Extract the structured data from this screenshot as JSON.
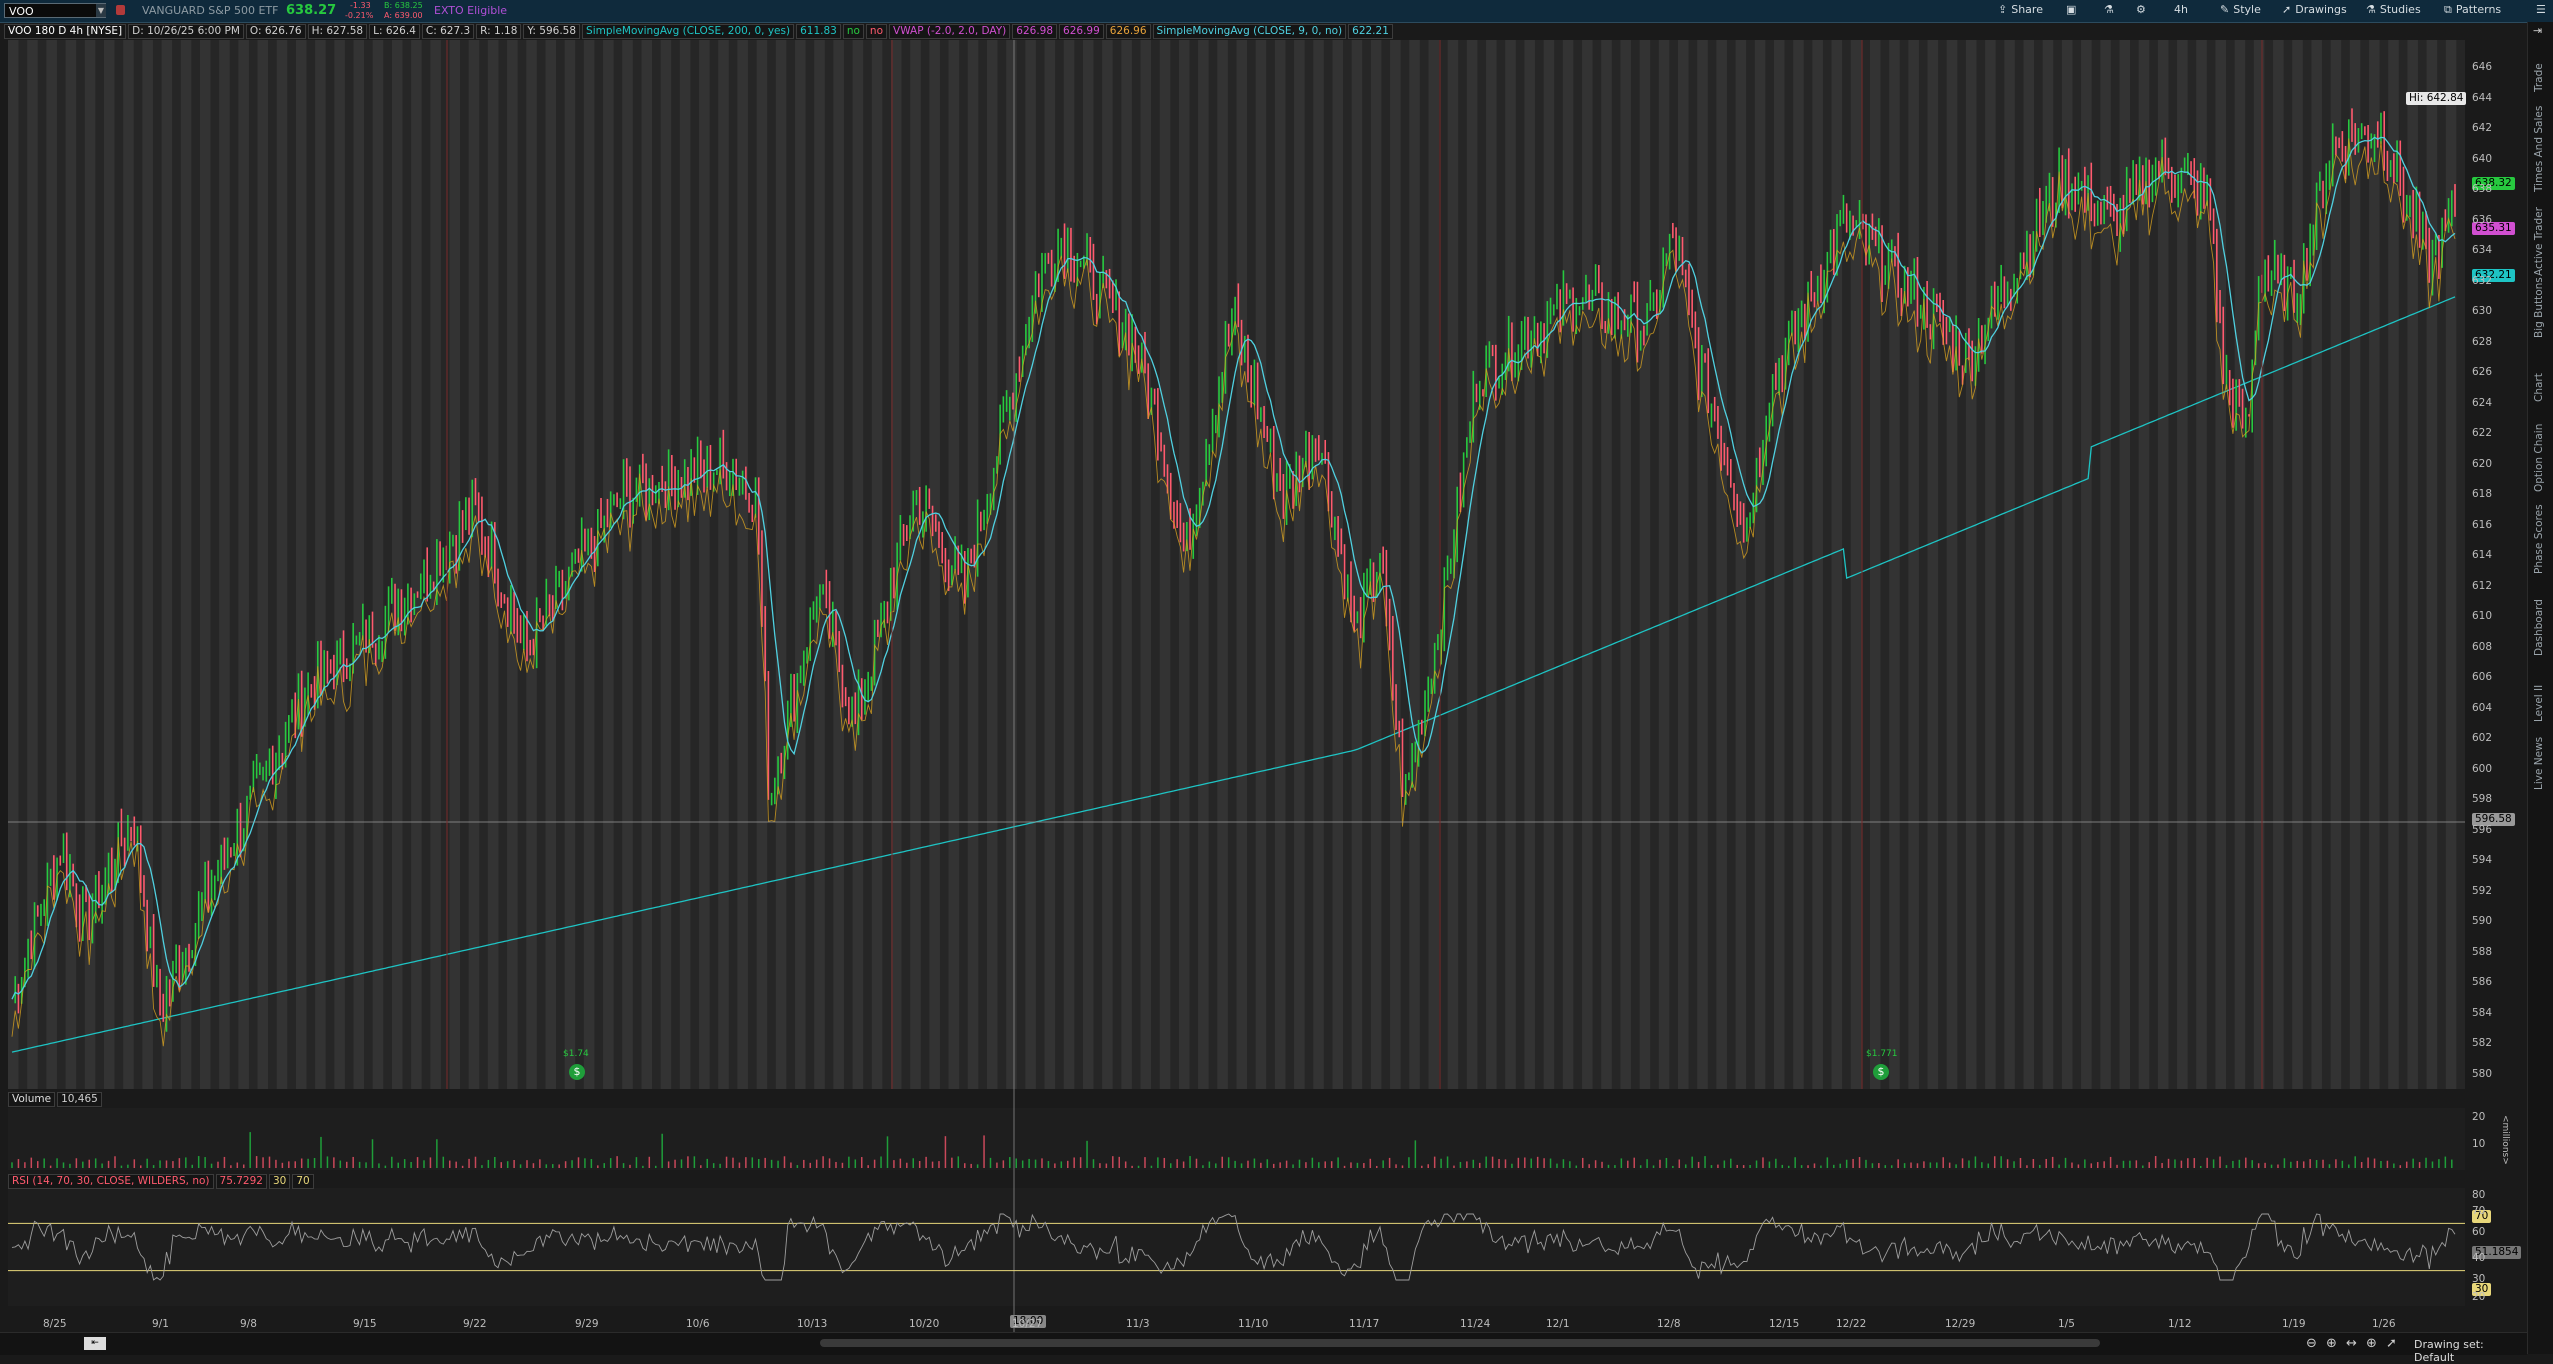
{
  "header": {
    "symbol": "VOO",
    "description": "VANGUARD S&P 500 ETF",
    "last": "638.27",
    "change": "-1.33",
    "change_pct": "-0.21%",
    "bid": "B: 638.25",
    "ask": "A: 639.00",
    "exto": "EXTO Eligible",
    "buttons": [
      "Share",
      "4h",
      "Style",
      "Drawings",
      "Studies",
      "Patterns"
    ]
  },
  "studies": {
    "title": "VOO 180 D 4h [NYSE]",
    "d": "D: 10/26/25 6:00 PM",
    "o": "O: 626.76",
    "h": "H: 627.58",
    "l": "L: 626.4",
    "c": "C: 627.3",
    "r": "R: 1.18",
    "y": "Y: 596.58",
    "sma200": "SimpleMovingAvg (CLOSE, 200, 0, yes)",
    "sma200_val": "611.83",
    "no1": "no",
    "no2": "no",
    "vwap": "VWAP (-2.0, 2.0, DAY)",
    "vwap_vals": [
      "626.98",
      "626.99",
      "626.96"
    ],
    "sma9": "SimpleMovingAvg (CLOSE, 9, 0, no)",
    "sma9_val": "622.21"
  },
  "price_axis": {
    "ticks": [
      "646",
      "644",
      "642",
      "640",
      "638",
      "636",
      "634",
      "632",
      "630",
      "628",
      "626",
      "624",
      "622",
      "620",
      "618",
      "616",
      "614",
      "612",
      "610",
      "608",
      "606",
      "604",
      "602",
      "600",
      "598",
      "596",
      "594",
      "592",
      "590",
      "588",
      "586",
      "584",
      "582",
      "580"
    ],
    "hi_label": "Hi: 642.84",
    "tag_last": "638.32",
    "tag_vwap": "635.31",
    "tag_sma": "632.21",
    "tag_cursor": "596.58"
  },
  "date_axis": [
    "8/25",
    "9/1",
    "9/8",
    "9/15",
    "9/22",
    "9/29",
    "10/6",
    "10/13",
    "10/20",
    "10/27",
    "11/3",
    "11/10",
    "11/17",
    "11/24",
    "12/1",
    "12/8",
    "12/15",
    "12/22",
    "12/29",
    "1/5",
    "1/12",
    "1/19",
    "1/26"
  ],
  "cursor_time": "18:00",
  "dividends": [
    "$1.74",
    "$1.771"
  ],
  "volume": {
    "label": "Volume",
    "value": "10,465",
    "axis": [
      "20",
      "10"
    ],
    "unit": "<millions>"
  },
  "rsi": {
    "label": "RSI (14, 70, 30, CLOSE, WILDERS, no)",
    "value": "75.7292",
    "ob": "30",
    "os": "70",
    "axis": [
      "80",
      "70",
      "60",
      "40",
      "30",
      "20"
    ],
    "tag_70": "70",
    "tag_val": "51.1854",
    "tag_30": "30"
  },
  "sidebar_tabs": [
    "Trade",
    "Times And Sales",
    "Active Trader",
    "Big Buttons",
    "Chart",
    "Option Chain",
    "Phase Scores",
    "Dashboard",
    "Level II",
    "Live News"
  ],
  "footer": {
    "drawing_set": "Drawing set: Default"
  },
  "colors": {
    "bg": "#1a1a1a",
    "up": "#27c93f",
    "down": "#ff5a6e",
    "sma200": "#1ec4c4",
    "sma9": "#4fd0e0",
    "vwap": "#d14fd1"
  }
}
